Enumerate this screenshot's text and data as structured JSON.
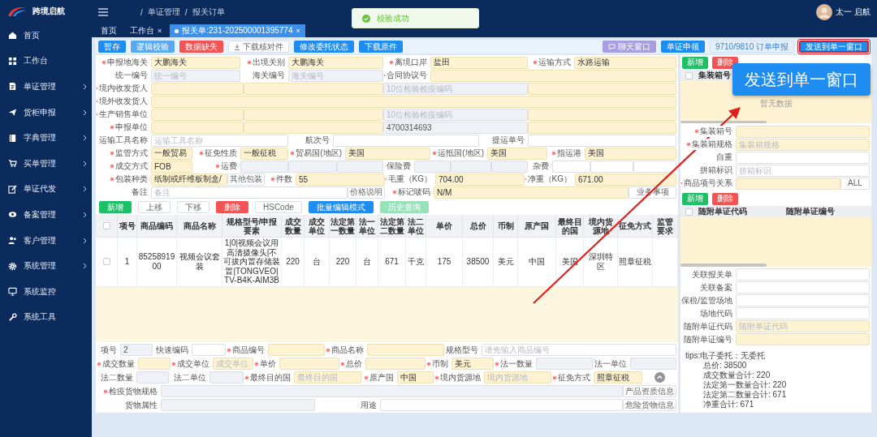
{
  "sidebar": {
    "brand": "跨境启航",
    "items": [
      {
        "label": "首页",
        "kind": "link"
      },
      {
        "label": "工作台",
        "kind": "link"
      },
      {
        "label": "单证管理",
        "kind": "group"
      },
      {
        "label": "货柜申报",
        "kind": "group"
      },
      {
        "label": "字典管理",
        "kind": "group"
      },
      {
        "label": "买单管理",
        "kind": "group"
      },
      {
        "label": "单证代发",
        "kind": "group"
      },
      {
        "label": "备案管理",
        "kind": "group"
      },
      {
        "label": "客户管理",
        "kind": "group"
      },
      {
        "label": "系统管理",
        "kind": "group"
      },
      {
        "label": "系统监控",
        "kind": "link"
      },
      {
        "label": "系统工具",
        "kind": "link"
      }
    ]
  },
  "header": {
    "breadcrumb": {
      "separator": "/",
      "items": [
        "单证管理",
        "报关订单"
      ]
    },
    "toast": "校验成功",
    "user": "太一 启航"
  },
  "tabs": [
    {
      "label": "首页",
      "selected": false
    },
    {
      "label": "工作台",
      "selected": false,
      "close": "×"
    },
    {
      "label": "报关单:231-202500001395774",
      "selected": true,
      "close": "×"
    }
  ],
  "actions": {
    "left": [
      {
        "text": "暂存",
        "kind": "primary"
      },
      {
        "text": "逻辑校验",
        "kind": "light"
      },
      {
        "text": "数据缺失",
        "kind": "danger"
      },
      {
        "text": "下载核对件",
        "kind": "download"
      },
      {
        "text": "修改委托状态",
        "kind": "primary"
      },
      {
        "text": "下载原件",
        "kind": "primary"
      }
    ],
    "right": [
      {
        "text": "聊天窗口",
        "kind": "chat",
        "highlighted": false
      },
      {
        "text": "单证申领",
        "kind": "primary",
        "highlighted": false
      },
      {
        "text": "9710/9810 订单申报",
        "kind": "pale",
        "highlighted": false
      },
      {
        "text": "发送到单一窗口",
        "kind": "primary",
        "highlighted": true
      }
    ]
  },
  "declaration_form": {
    "rows": [
      {
        "fields": [
          {
            "kind": "label",
            "text": "申报地海关",
            "required": true
          },
          {
            "kind": "mandatory",
            "value": "大鹏海关"
          },
          {
            "kind": "label",
            "text": "出境关别",
            "required": true
          },
          {
            "kind": "mandatory",
            "value": "大鹏海关"
          },
          {
            "kind": "label",
            "text": "离境口岸",
            "required": true
          },
          {
            "kind": "mandatory",
            "value": "盐田"
          },
          {
            "kind": "label",
            "text": "运输方式",
            "required": true
          },
          {
            "kind": "mandatory",
            "value": "水路运输"
          }
        ]
      },
      {
        "fields": [
          {
            "kind": "label",
            "text": "统一编号",
            "required": false
          },
          {
            "kind": "locked",
            "placeholder": "统一编号"
          },
          {
            "kind": "label",
            "text": "海关编号",
            "required": false
          },
          {
            "kind": "locked",
            "placeholder": "海关编号"
          },
          {
            "kind": "label",
            "text": "合同协议号",
            "required": true
          },
          {
            "kind": "mandatory"
          }
        ]
      },
      {
        "fields": [
          {
            "kind": "label",
            "text": "境内收发货人",
            "required": true
          },
          {
            "kind": "mandatory"
          },
          {
            "kind": "mandatory"
          },
          {
            "kind": "locked",
            "placeholder": "10位检验检疫编码"
          },
          {
            "kind": "mandatory"
          }
        ]
      },
      {
        "fields": [
          {
            "kind": "label",
            "text": "境外收发货人",
            "required": true
          },
          {
            "kind": "mandatory"
          }
        ]
      },
      {
        "fields": [
          {
            "kind": "label",
            "text": "生产销售单位",
            "required": true
          },
          {
            "kind": "mandatory"
          },
          {
            "kind": "mandatory"
          },
          {
            "kind": "locked",
            "placeholder": "10位检验检疫编码"
          },
          {
            "kind": "mandatory"
          }
        ]
      },
      {
        "fields": [
          {
            "kind": "label",
            "text": "申报单位",
            "required": true
          },
          {
            "kind": "mandatory"
          },
          {
            "kind": "mandatory"
          },
          {
            "kind": "locked",
            "value": "4700314693"
          },
          {
            "kind": "mandatory"
          }
        ]
      },
      {
        "fields": [
          {
            "kind": "label",
            "text": "运输工具名称",
            "required": false
          },
          {
            "kind": "input",
            "placeholder": "运输工具名称"
          },
          {
            "kind": "label",
            "text": "航次号",
            "required": false
          },
          {
            "kind": "input"
          },
          {
            "kind": "label",
            "text": "提运单号",
            "required": false
          },
          {
            "kind": "input"
          }
        ]
      },
      {
        "fields": [
          {
            "kind": "label",
            "text": "监管方式",
            "required": true
          },
          {
            "kind": "mandatory",
            "value": "一般贸易"
          },
          {
            "kind": "label",
            "text": "征免性质",
            "required": true
          },
          {
            "kind": "mandatory",
            "value": "一般征税"
          },
          {
            "kind": "label",
            "text": "贸易国(地区)",
            "required": true
          },
          {
            "kind": "mandatory",
            "value": "美国"
          },
          {
            "kind": "label",
            "text": "运抵国(地区)",
            "required": true
          },
          {
            "kind": "mandatory",
            "value": "美国"
          },
          {
            "kind": "label",
            "text": "指运港",
            "required": true
          },
          {
            "kind": "mandatory",
            "value": "美国"
          }
        ]
      },
      {
        "fields": [
          {
            "kind": "label",
            "text": "成交方式",
            "required": true
          },
          {
            "kind": "mandatory",
            "value": "FOB"
          },
          {
            "kind": "label",
            "text": "运费",
            "required": true
          },
          {
            "kind": "locked"
          },
          {
            "kind": "locked"
          },
          {
            "kind": "locked"
          },
          {
            "kind": "label",
            "text": "保险费",
            "required": false
          },
          {
            "kind": "locked"
          },
          {
            "kind": "locked"
          },
          {
            "kind": "locked"
          },
          {
            "kind": "label",
            "text": "杂费",
            "required": false
          },
          {
            "kind": "input"
          },
          {
            "kind": "input"
          },
          {
            "kind": "input"
          }
        ]
      },
      {
        "fields": [
          {
            "kind": "label",
            "text": "包装种类",
            "required": true
          },
          {
            "kind": "mandatory",
            "value": "纸制或纤维板制盒/"
          },
          {
            "kind": "button",
            "text": "其他包装"
          },
          {
            "kind": "label",
            "text": "件数",
            "required": true
          },
          {
            "kind": "mandatory",
            "value": "55"
          },
          {
            "kind": "label",
            "text": "毛重（KG）",
            "required": true
          },
          {
            "kind": "mandatory",
            "value": "704.00"
          },
          {
            "kind": "label",
            "text": "净重（KG）",
            "required": true
          },
          {
            "kind": "mandatory",
            "value": "671.00"
          }
        ]
      },
      {
        "fields": [
          {
            "kind": "label",
            "text": "备注",
            "required": false
          },
          {
            "kind": "input",
            "placeholder": "备注"
          },
          {
            "kind": "button",
            "text": "价格说明"
          },
          {
            "kind": "label",
            "text": "标记唛码",
            "required": true
          },
          {
            "kind": "mandatory",
            "value": "N/M"
          },
          {
            "kind": "button",
            "text": "业务事项"
          }
        ]
      }
    ]
  },
  "goods": {
    "toolbar": [
      {
        "text": "新增",
        "kind": "success",
        "disabled": false
      },
      {
        "text": "上移",
        "kind": "plain",
        "disabled": false
      },
      {
        "text": "下移",
        "kind": "plain",
        "disabled": false
      },
      {
        "text": "删除",
        "kind": "danger",
        "disabled": false
      },
      {
        "text": "HSCode",
        "kind": "plain",
        "disabled": false
      },
      {
        "text": "批量编辑模式",
        "kind": "primary",
        "disabled": false
      },
      {
        "text": "历史查询",
        "kind": "success",
        "disabled": true
      }
    ],
    "header_checked": false,
    "columns": [
      "项号",
      "商品编码",
      "商品名称",
      "规格型号/申报要素",
      "成交数量",
      "成交单位",
      "法定第一数量",
      "法一单位",
      "法定第二数量",
      "法二单位",
      "单价",
      "总价",
      "币制",
      "原产国",
      "最终目的国",
      "境内货源地",
      "征免方式",
      "监管要求"
    ],
    "rows": [
      {
        "checked": false,
        "cells": [
          "1",
          "8525891900",
          "视频会议套装",
          "1|0|视频会议用高清摄像头|不可拔内置存储装置|TONGVEO|TV-B4K-AIM3B",
          "220",
          "台",
          "220",
          "台",
          "671",
          "千克",
          "175",
          "38500",
          "美元",
          "中国",
          "美国",
          "深圳特区",
          "照章征税",
          ""
        ]
      }
    ]
  },
  "item_form": {
    "rows": [
      {
        "fields": [
          {
            "kind": "label",
            "text": "项号",
            "required": false
          },
          {
            "kind": "locked",
            "value": "2"
          },
          {
            "kind": "label",
            "text": "快速编码",
            "required": false
          },
          {
            "kind": "input"
          },
          {
            "kind": "label",
            "text": "商品编号",
            "required": true
          },
          {
            "kind": "mandatory"
          },
          {
            "kind": "label",
            "text": "商品名称",
            "required": true
          },
          {
            "kind": "mandatory"
          },
          {
            "kind": "label",
            "text": "规格型号",
            "required": false
          },
          {
            "kind": "input",
            "placeholder": "请先输入商品编号"
          }
        ]
      },
      {
        "fields": [
          {
            "kind": "label",
            "text": "成交数量",
            "required": true
          },
          {
            "kind": "mandatory"
          },
          {
            "kind": "label",
            "text": "成交单位",
            "required": true
          },
          {
            "kind": "mandatory",
            "placeholder": "成交单位"
          },
          {
            "kind": "label",
            "text": "单价",
            "required": true
          },
          {
            "kind": "mandatory"
          },
          {
            "kind": "label",
            "text": "总价",
            "required": true
          },
          {
            "kind": "mandatory"
          },
          {
            "kind": "label",
            "text": "币制",
            "required": true
          },
          {
            "kind": "mandatory",
            "value": "美元"
          },
          {
            "kind": "label",
            "text": "法一数量",
            "required": true
          },
          {
            "kind": "locked"
          },
          {
            "kind": "label",
            "text": "法一单位",
            "required": false
          },
          {
            "kind": "locked"
          }
        ]
      },
      {
        "fields": [
          {
            "kind": "label",
            "text": "法二数量",
            "required": false
          },
          {
            "kind": "locked"
          },
          {
            "kind": "label",
            "text": "法二单位",
            "required": false
          },
          {
            "kind": "locked"
          },
          {
            "kind": "label",
            "text": "最终目的国",
            "required": true
          },
          {
            "kind": "mandatory",
            "placeholder": "最终目的国"
          },
          {
            "kind": "label",
            "text": "原产国",
            "required": true
          },
          {
            "kind": "mandatory",
            "value": "中国"
          },
          {
            "kind": "label",
            "text": "境内货源地",
            "required": true
          },
          {
            "kind": "mandatory",
            "placeholder": "境内货源地"
          },
          {
            "kind": "label",
            "text": "征免方式",
            "required": true
          },
          {
            "kind": "mandatory",
            "value": "照章征税"
          },
          {
            "kind": "collapse"
          }
        ]
      },
      {
        "fields": [
          {
            "kind": "label",
            "text": "检疫货物规格",
            "required": true
          },
          {
            "kind": "locked"
          },
          {
            "kind": "button",
            "text": "产品资质信息"
          }
        ]
      },
      {
        "fields": [
          {
            "kind": "label",
            "text": "货物属性",
            "required": false
          },
          {
            "kind": "locked"
          },
          {
            "kind": "label",
            "text": "用途",
            "required": false
          },
          {
            "kind": "input"
          },
          {
            "kind": "button",
            "text": "危险货物信息"
          }
        ]
      }
    ]
  },
  "side_panel": {
    "sections": [
      {
        "buttons": [
          {
            "text": "新增",
            "kind": "success"
          },
          {
            "text": "删除",
            "kind": "danger"
          }
        ],
        "header_checked": false,
        "columns": [
          "集装箱号"
        ],
        "empty_text": "暂无数据",
        "form": [
          {
            "fields": [
              {
                "kind": "label",
                "text": "集装箱号",
                "required": true
              },
              {
                "kind": "mandatory"
              }
            ]
          },
          {
            "fields": [
              {
                "kind": "label",
                "text": "集装箱规格",
                "required": true
              },
              {
                "kind": "mandatory",
                "placeholder": "集装箱规格"
              }
            ]
          },
          {
            "fields": [
              {
                "kind": "label",
                "text": "自重",
                "required": false
              },
              {
                "kind": "input"
              }
            ]
          },
          {
            "fields": [
              {
                "kind": "label",
                "text": "拼箱标识",
                "required": false
              },
              {
                "kind": "input",
                "placeholder": "拼箱标识"
              }
            ]
          },
          {
            "fields": [
              {
                "kind": "label",
                "text": "商品项号关系",
                "required": true
              },
              {
                "kind": "mandatory"
              },
              {
                "kind": "button",
                "text": "ALL"
              }
            ]
          }
        ]
      },
      {
        "buttons": [
          {
            "text": "新增",
            "kind": "success"
          },
          {
            "text": "删除",
            "kind": "danger"
          }
        ],
        "header_checked": false,
        "columns": [
          "随附单证代码",
          "随附单证编号"
        ],
        "form": [
          {
            "fields": [
              {
                "kind": "label",
                "text": "关联报关单",
                "required": false
              },
              {
                "kind": "input"
              }
            ]
          },
          {
            "fields": [
              {
                "kind": "label",
                "text": "关联备案",
                "required": false
              },
              {
                "kind": "input"
              }
            ]
          },
          {
            "fields": [
              {
                "kind": "label",
                "text": "保税/监管场地",
                "required": false
              },
              {
                "kind": "input"
              }
            ]
          },
          {
            "fields": [
              {
                "kind": "label",
                "text": "场地代码",
                "required": false
              },
              {
                "kind": "input"
              }
            ]
          },
          {
            "fields": [
              {
                "kind": "label",
                "text": "随附单证代码",
                "required": false
              },
              {
                "kind": "mandatory",
                "placeholder": "随附单证代码"
              }
            ]
          },
          {
            "fields": [
              {
                "kind": "label",
                "text": "随附单证编号",
                "required": false
              },
              {
                "kind": "mandatory"
              }
            ]
          }
        ]
      }
    ],
    "tips": {
      "title": "tips:电子委托：无委托",
      "lines": [
        "总价: 38500",
        "成交数量合计: 220",
        "法定第一数量合计: 220",
        "法定第二数量合计: 671",
        "净重合计: 671"
      ]
    }
  },
  "annotation": {
    "callout": "发送到单一窗口"
  }
}
